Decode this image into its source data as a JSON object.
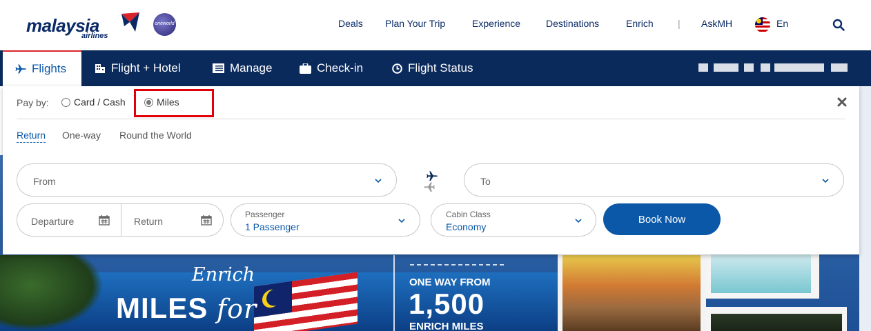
{
  "brand": {
    "logo_text": "malaysia",
    "logo_sub": "airlines",
    "alliance": "oneworld"
  },
  "topnav": {
    "items": [
      "Deals",
      "Plan Your Trip",
      "Experience",
      "Destinations",
      "Enrich",
      "|",
      "AskMH"
    ],
    "language": "En"
  },
  "tabs": [
    {
      "label": "Flights",
      "icon": "plane-icon",
      "active": true
    },
    {
      "label": "Flight + Hotel",
      "icon": "building-icon",
      "active": false
    },
    {
      "label": "Manage",
      "icon": "list-icon",
      "active": false
    },
    {
      "label": "Check-in",
      "icon": "briefcase-icon",
      "active": false
    },
    {
      "label": "Flight Status",
      "icon": "clock-icon",
      "active": false
    }
  ],
  "booking": {
    "pay_by_label": "Pay by:",
    "pay_options": [
      {
        "label": "Card / Cash",
        "selected": false
      },
      {
        "label": "Miles",
        "selected": true
      }
    ],
    "trip_types": [
      {
        "label": "Return",
        "active": true
      },
      {
        "label": "One-way",
        "active": false
      },
      {
        "label": "Round the World",
        "active": false
      }
    ],
    "from_placeholder": "From",
    "to_placeholder": "To",
    "departure_placeholder": "Departure",
    "return_placeholder": "Return",
    "passenger": {
      "label": "Passenger",
      "value": "1 Passenger"
    },
    "cabin": {
      "label": "Cabin Class",
      "value": "Economy"
    },
    "book_label": "Book Now"
  },
  "hero": {
    "enrich": "Enrich",
    "miles_word": "MILES",
    "for_word": "for",
    "deal_line1": "ONE WAY FROM",
    "deal_amount": "1,500",
    "deal_line3": "ENRICH MILES"
  },
  "colors": {
    "navy": "#0b2a5c",
    "accent": "#0b58a8",
    "highlight": "#e0000b"
  }
}
